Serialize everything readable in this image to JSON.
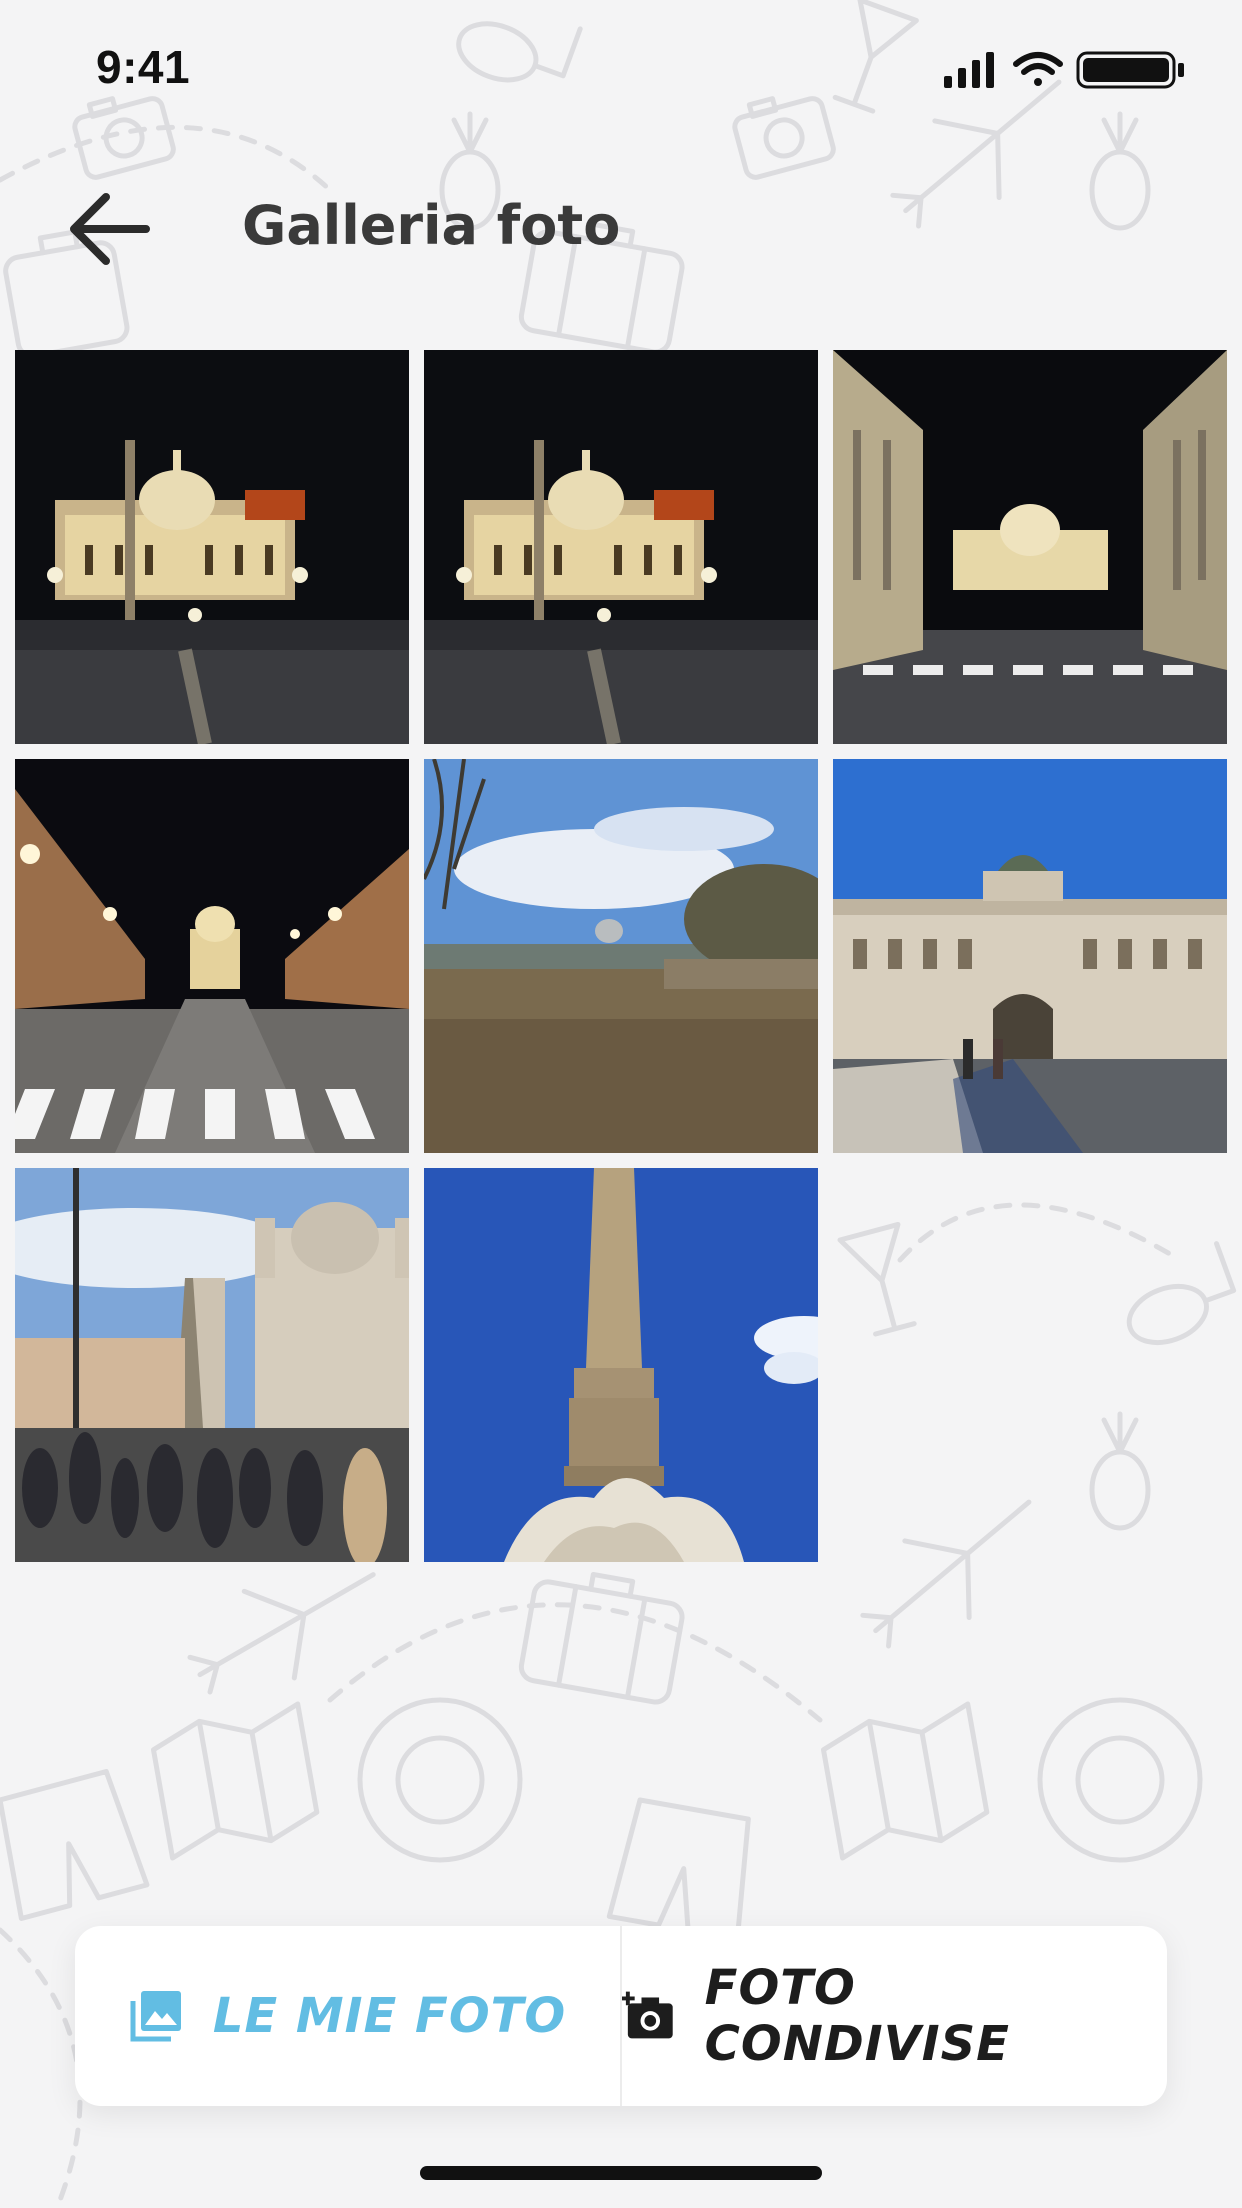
{
  "status_bar": {
    "time": "9:41",
    "icons": [
      "signal-icon",
      "wifi-icon",
      "battery-icon"
    ]
  },
  "header": {
    "title": "Galleria foto",
    "back_icon": "arrow-left-icon"
  },
  "gallery": {
    "photos": [
      {
        "scene": "st-peters-night"
      },
      {
        "scene": "st-peters-night"
      },
      {
        "scene": "st-peters-street-night"
      },
      {
        "scene": "via-conciliazione-night"
      },
      {
        "scene": "tiber-river-day"
      },
      {
        "scene": "palace-of-justice-day"
      },
      {
        "scene": "piazza-navona-day"
      },
      {
        "scene": "obelisk-fountain-day"
      }
    ]
  },
  "tabs": {
    "my_photos": {
      "label": "LE MIE FOTO",
      "icon": "image-gallery-icon",
      "active": true
    },
    "shared_photos": {
      "label": "FOTO CONDIVISE",
      "icon": "add-camera-icon",
      "active": false
    }
  },
  "colors": {
    "accent": "#62bde3",
    "title": "#3a3a3a",
    "background": "#f4f4f5",
    "pattern": "#d7d7da"
  }
}
